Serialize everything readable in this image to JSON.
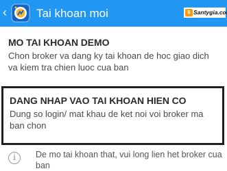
{
  "header": {
    "back_icon": "chevron-left-icon",
    "logo_icon": "app-logo-icon",
    "title": "Tai khoan moi",
    "watermark": "Santygia.com",
    "bg_color": "#2196f3"
  },
  "options": [
    {
      "title": "MO TAI KHOAN DEMO",
      "description": "Chon broker va dang ky tai khoan de hoc giao dich va kiem tra chien luoc cua ban"
    },
    {
      "title": "DANG NHAP VAO TAI KHOAN HIEN CO",
      "description": "Dung so login/ mat khau de ket noi voi broker ma ban chon"
    }
  ],
  "info": {
    "icon": "info-icon",
    "text": "De mo tai khoan that, vui long lien het broker cua ban"
  }
}
